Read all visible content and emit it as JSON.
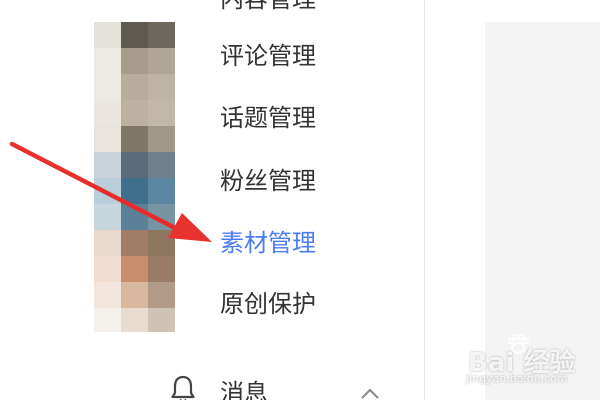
{
  "sidebar": {
    "items": [
      {
        "label": "内容管理",
        "active": false
      },
      {
        "label": "评论管理",
        "active": false
      },
      {
        "label": "话题管理",
        "active": false
      },
      {
        "label": "粉丝管理",
        "active": false
      },
      {
        "label": "素材管理",
        "active": true
      },
      {
        "label": "原创保护",
        "active": false
      }
    ],
    "message": {
      "label": "消息",
      "icon": "bell-icon",
      "toggle_icon": "chevron-up-icon"
    }
  },
  "colors": {
    "text": "#333333",
    "active": "#4c7cf3",
    "arrow": "#e8322f",
    "divider": "#e8e8e8"
  },
  "watermark": {
    "brand": "Bai 经验",
    "url": "jingyan.baidu.com"
  }
}
